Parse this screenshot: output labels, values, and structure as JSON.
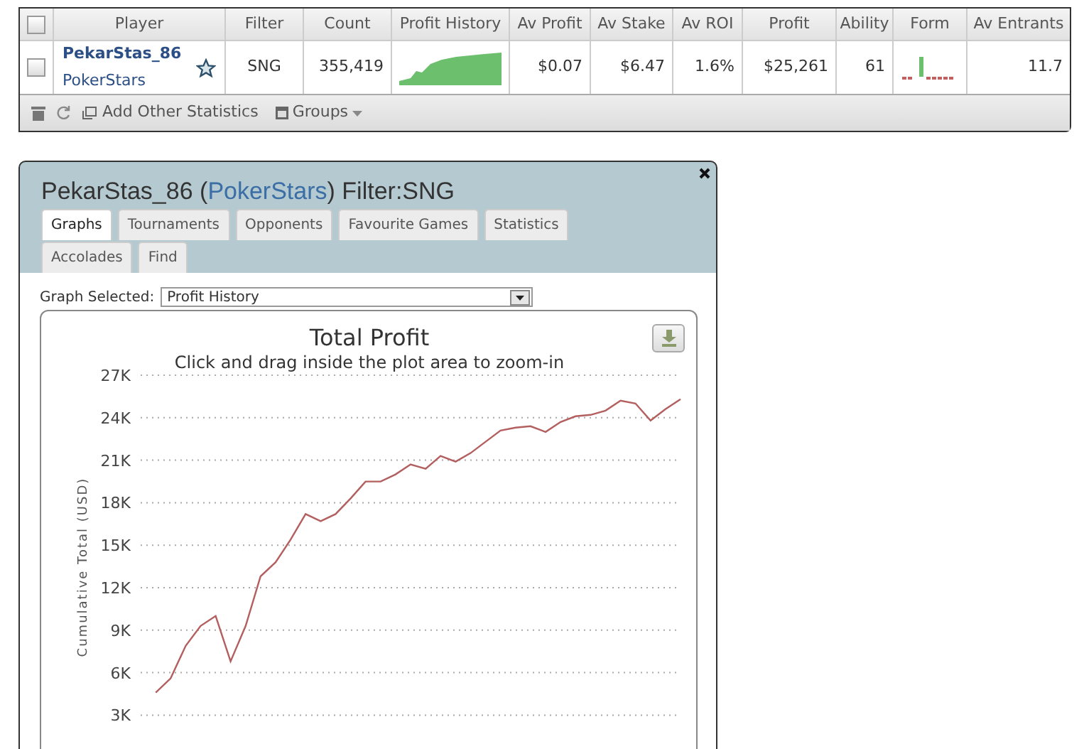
{
  "table": {
    "columns": [
      "Player",
      "Filter",
      "Count",
      "Profit History",
      "Av Profit",
      "Av Stake",
      "Av ROI",
      "Profit",
      "Ability",
      "Form",
      "Av Entrants"
    ],
    "header_checked": false,
    "rows": [
      {
        "checked": false,
        "player": "PekarStas_86",
        "site": "PokerStars",
        "filter": "SNG",
        "count": "355,419",
        "av_profit": "$0.07",
        "av_stake": "$6.47",
        "av_roi": "1.6%",
        "profit": "$25,261",
        "ability": "61",
        "av_entrants": "11.7"
      }
    ],
    "footer": {
      "add_label": "Add Other Statistics",
      "groups_label": "Groups"
    }
  },
  "dialog": {
    "title_name": "PekarStas_86 (",
    "title_site": "PokerStars",
    "title_filter": ") Filter:SNG",
    "tabs": [
      {
        "label": "Graphs",
        "selected": true
      },
      {
        "label": "Tournaments",
        "selected": false
      },
      {
        "label": "Opponents",
        "selected": false
      },
      {
        "label": "Favourite Games",
        "selected": false
      },
      {
        "label": "Statistics",
        "selected": false
      },
      {
        "label": "Accolades",
        "selected": false
      },
      {
        "label": "Find",
        "selected": false
      }
    ],
    "graph_selected_label": "Graph Selected:",
    "graph_selected_value": "Profit History",
    "chart_data": {
      "type": "line",
      "title": "Total Profit",
      "subtitle": "Click and drag inside the plot area to zoom-in",
      "ylabel": "Cumulative Total (USD)",
      "grid": true,
      "ylim": [
        3000,
        27000
      ],
      "yticks": [
        {
          "value": 3000,
          "label": "3K"
        },
        {
          "value": 6000,
          "label": "6K"
        },
        {
          "value": 9000,
          "label": "9K"
        },
        {
          "value": 12000,
          "label": "12K"
        },
        {
          "value": 15000,
          "label": "15K"
        },
        {
          "value": 18000,
          "label": "18K"
        },
        {
          "value": 21000,
          "label": "21K"
        },
        {
          "value": 24000,
          "label": "24K"
        },
        {
          "value": 27000,
          "label": "27K"
        }
      ],
      "series": [
        {
          "color": "#b35f5f",
          "values": [
            null,
            4600,
            5600,
            7900,
            9300,
            10000,
            6800,
            9300,
            12800,
            13800,
            15400,
            17200,
            16700,
            17200,
            18300,
            19500,
            19500,
            20000,
            20700,
            20400,
            21300,
            20900,
            21500,
            22300,
            23100,
            23300,
            23400,
            23000,
            23700,
            24100,
            24200,
            24500,
            25200,
            25000,
            23800,
            24600,
            25300
          ]
        }
      ]
    }
  }
}
